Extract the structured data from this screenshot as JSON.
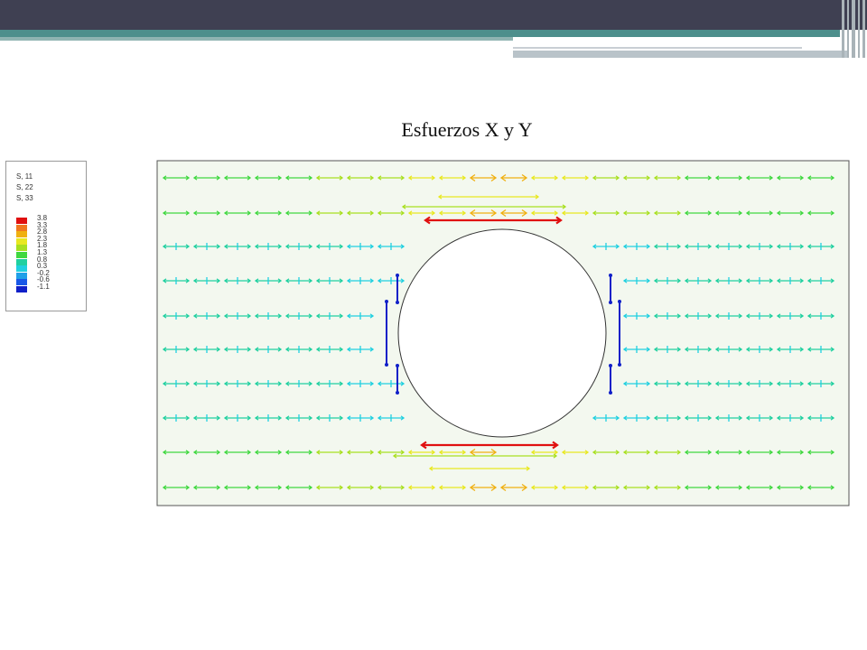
{
  "slide": {
    "title": "Esfuerzos X y Y"
  },
  "legend": {
    "headers": [
      "S, 11",
      "S, 22",
      "S, 33"
    ],
    "ticks": [
      "3.8",
      "3.3",
      "2.8",
      "2.3",
      "1.8",
      "1.3",
      "0.8",
      "0.3",
      "-0.2",
      "-0.6",
      "-1.1"
    ],
    "colors": [
      "#e01010",
      "#f07820",
      "#f0b010",
      "#e8e820",
      "#a8e020",
      "#40d840",
      "#20d0a0",
      "#20d0e0",
      "#20a0e8",
      "#1858e8",
      "#1020c8"
    ]
  },
  "plot": {
    "background": "#f3f8ef",
    "hole_fill": "#ffffff",
    "border": "#555555"
  }
}
